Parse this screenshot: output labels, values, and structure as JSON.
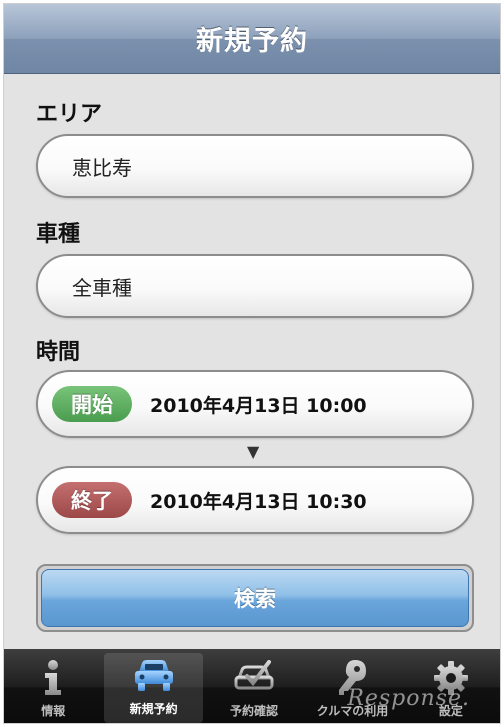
{
  "header": {
    "title": "新規予約"
  },
  "area": {
    "label": "エリア",
    "value": "恵比寿"
  },
  "car_type": {
    "label": "車種",
    "value": "全車種"
  },
  "time": {
    "label": "時間",
    "start": {
      "badge": "開始",
      "value": "2010年4月13日 10:00"
    },
    "arrow": "▼",
    "end": {
      "badge": "終了",
      "value": "2010年4月13日 10:30"
    }
  },
  "search": {
    "label": "検索"
  },
  "tabbar": {
    "items": [
      {
        "label": "情報",
        "icon": "info-icon",
        "selected": false
      },
      {
        "label": "新規予約",
        "icon": "car-icon",
        "selected": true
      },
      {
        "label": "予約確認",
        "icon": "reservation-check-icon",
        "selected": false
      },
      {
        "label": "クルマの利用",
        "icon": "key-icon",
        "selected": false
      },
      {
        "label": "設定",
        "icon": "gear-icon",
        "selected": false
      }
    ]
  },
  "watermark": "Response.",
  "colors": {
    "navbar": "#7b91ae",
    "start_badge": "#4a9c4e",
    "end_badge": "#9c4848",
    "search_button": "#6aa5db",
    "selected_tab_icon": "#5fa8e8"
  }
}
